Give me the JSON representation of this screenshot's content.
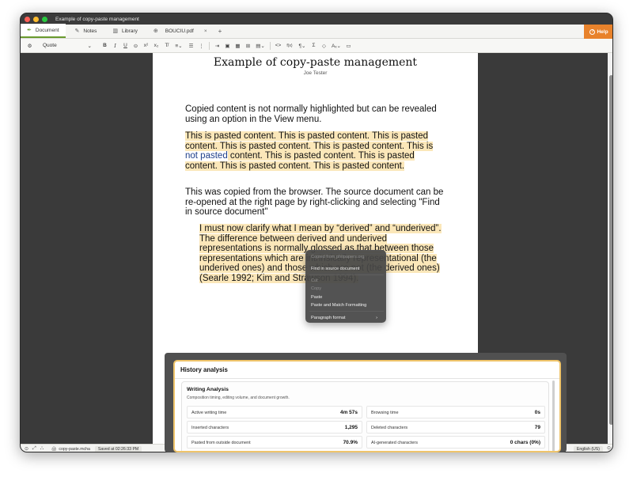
{
  "window": {
    "title": "Example of copy-paste management"
  },
  "tabs": [
    {
      "icon": "quill-icon",
      "glyph": "✒",
      "label": "Document"
    },
    {
      "icon": "edit-note-icon",
      "glyph": "✎",
      "label": "Notes"
    },
    {
      "icon": "library-icon",
      "glyph": "▥",
      "label": "Library"
    },
    {
      "icon": "globe-icon",
      "glyph": "⊕",
      "label": "BOUCIU.pdf",
      "close": "×"
    }
  ],
  "tab_add": "+",
  "help": {
    "label": "Help",
    "glyph": "?"
  },
  "toolbar": {
    "style_value": "Quote",
    "style_chevron": "⌄",
    "buttons": [
      {
        "name": "format-painter-icon",
        "glyph": "⚙"
      },
      {
        "name": "bold-button",
        "glyph": "B"
      },
      {
        "name": "italic-button",
        "glyph": "I"
      },
      {
        "name": "underline-button",
        "glyph": "U"
      },
      {
        "name": "link-icon",
        "glyph": "⊝"
      },
      {
        "name": "superscript-button",
        "glyph": "x²"
      },
      {
        "name": "subscript-button",
        "glyph": "x₂"
      },
      {
        "name": "clear-format-icon",
        "glyph": "T̸"
      },
      {
        "name": "align-icon",
        "glyph": "≡⌄"
      },
      {
        "name": "bullet-list-icon",
        "glyph": "☰"
      },
      {
        "name": "numbered-list-icon",
        "glyph": "⋮"
      },
      {
        "name": "indent-icon",
        "glyph": "⇥"
      },
      {
        "name": "image-icon",
        "glyph": "▣"
      },
      {
        "name": "gallery-icon",
        "glyph": "▦"
      },
      {
        "name": "table-icon",
        "glyph": "⊞"
      },
      {
        "name": "file-icon",
        "glyph": "▤⌄"
      },
      {
        "name": "code-icon",
        "glyph": "<>"
      },
      {
        "name": "formula-icon",
        "glyph": "f(x)"
      },
      {
        "name": "paragraph-mark-icon",
        "glyph": "¶⌄"
      },
      {
        "name": "sigma-icon",
        "glyph": "Σ"
      },
      {
        "name": "tag-icon",
        "glyph": "◇"
      },
      {
        "name": "translate-icon",
        "glyph": "Aₓ⌄"
      },
      {
        "name": "comment-icon",
        "glyph": "▭"
      }
    ]
  },
  "document": {
    "title": "Example of copy-paste management",
    "author": "Joe Tester",
    "p1": "Copied content is not normally highlighted but can be revealed using an option in the View menu.",
    "p2_a": "This is pasted content. This is pasted content. This is pasted content. This is pasted content. This is pasted content. This is ",
    "p2_np": "not pasted",
    "p2_b": " content. This is pasted content. This is pasted content. This is pasted content. This is pasted content.",
    "p3": "This was copied from the browser. The source document can be re-opened at the right page by right-clicking and selecting \"Find in source document\"",
    "quote": "I must now clarify what I mean by “derived” and “underived”. The difference between derived and underived representations is normally glossed as that between those representations which are intrinsically representational (the underived ones) and those which are not (the derived ones) (Searle 1992; Kim and Strawson 1994)."
  },
  "context_menu": {
    "items": [
      {
        "label": "Copied from philpapers.org",
        "disabled": true
      },
      {
        "label": "Find in source document",
        "disabled": false
      },
      {
        "label": "Cut",
        "disabled": true
      },
      {
        "label": "Copy",
        "disabled": true
      },
      {
        "label": "Paste",
        "disabled": false
      },
      {
        "label": "Paste and Match Formatting",
        "disabled": false
      },
      {
        "label": "Paragraph format",
        "disabled": false
      }
    ],
    "submenu_chevron": "›"
  },
  "history": {
    "title": "History analysis",
    "card_title": "Writing Analysis",
    "card_subtitle": "Composition timing, editing volume, and document growth.",
    "stats": [
      {
        "label": "Active writing time",
        "value": "4m 57s"
      },
      {
        "label": "Browsing time",
        "value": "0s"
      },
      {
        "label": "Inserted characters",
        "value": "1,295"
      },
      {
        "label": "Deleted characters",
        "value": "79"
      },
      {
        "label": "Pasted from outside document",
        "value": "70.9%"
      },
      {
        "label": "AI-generated characters",
        "value": "0 chars (0%)"
      }
    ]
  },
  "statusbar": {
    "icons": [
      "⊙",
      "⤢",
      "⛬"
    ],
    "file_icon": "🖨",
    "filename": "copy-paste.mcha",
    "saved": "Saved at 02:26:33 PM",
    "language": "English (US)",
    "right_icon": "⊙"
  }
}
